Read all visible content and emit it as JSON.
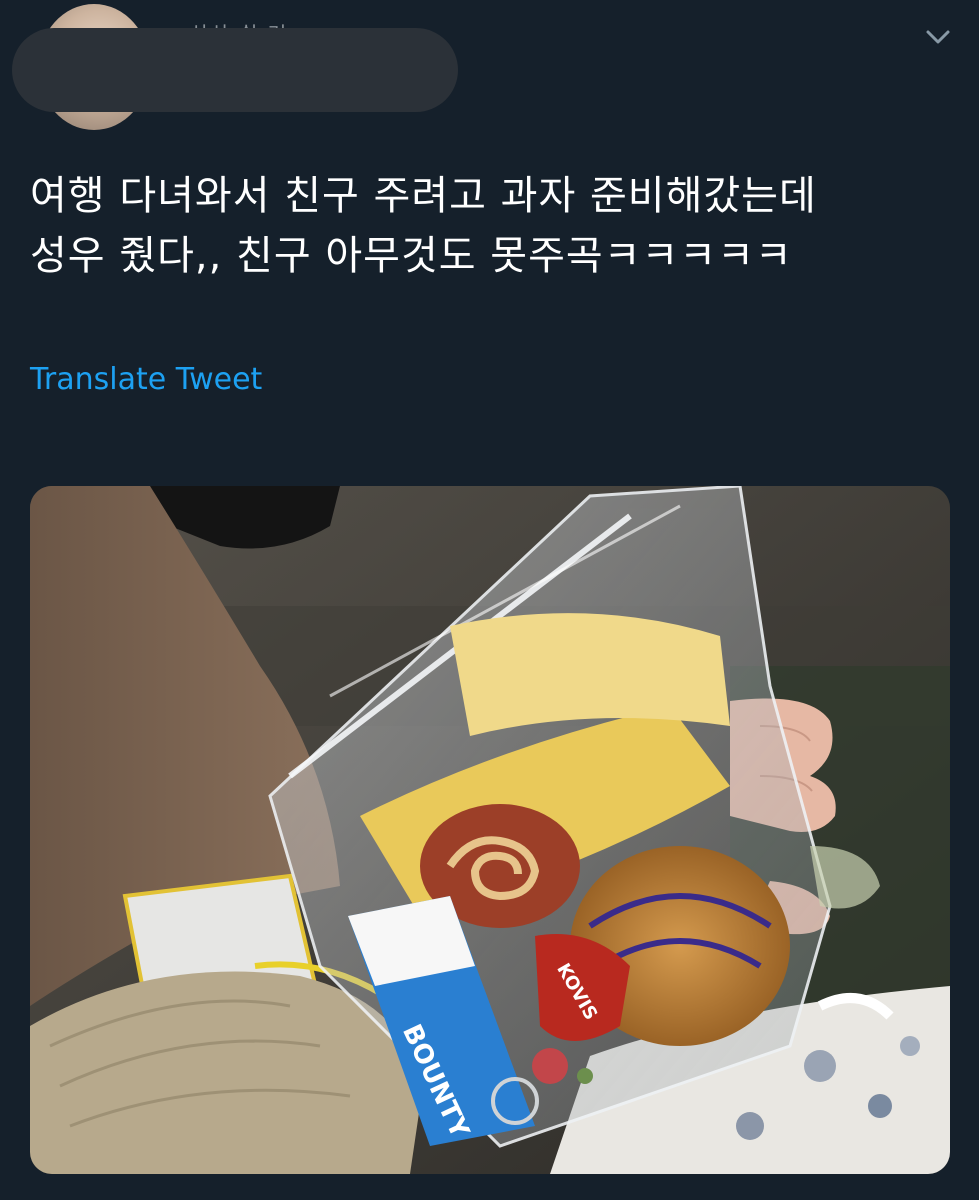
{
  "tweet": {
    "text": "여행 다녀와서 친구 주려고 과자 준비해갔는데\n성우 줬다,, 친구 아무것도 못주곡ㅋㅋㅋㅋㅋ",
    "translate_label": "Translate Tweet"
  },
  "media": {
    "bar_label": "BOUNTY",
    "pastry_label": "KOVIS"
  },
  "colors": {
    "background": "#15202b",
    "accent": "#1da1f2",
    "text": "#ffffff",
    "redaction": "#2b3138"
  },
  "icons": {
    "menu": "chevron-down-icon"
  }
}
